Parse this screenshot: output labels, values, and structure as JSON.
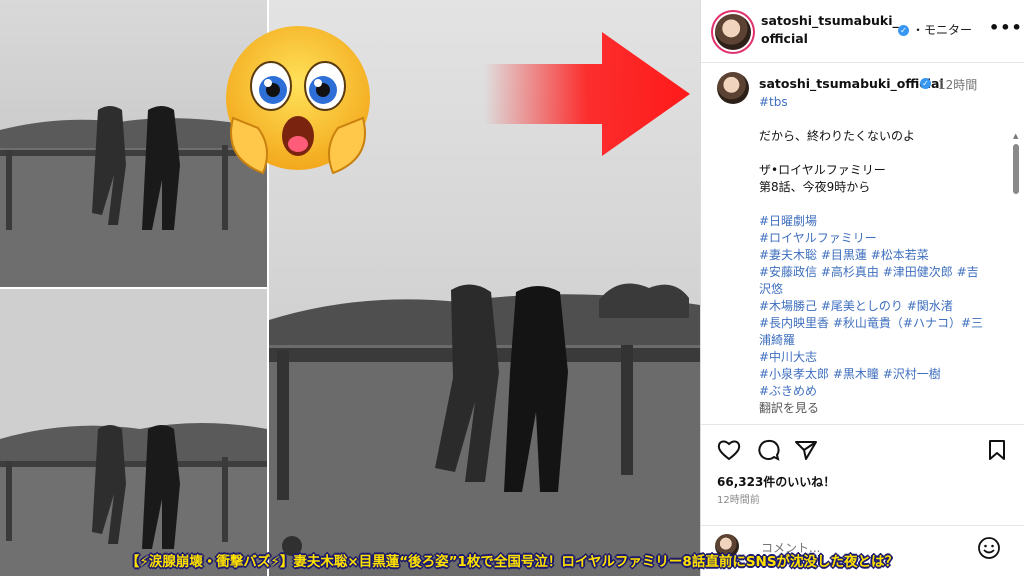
{
  "profile": {
    "username_header": "satoshi_tsumabuki_official",
    "follow_label": "・モニター",
    "verified_mark": "✓"
  },
  "caption": {
    "username": "satoshi_tsumabuki_official",
    "time": "12時間",
    "hashtag_top": "#tbs",
    "line1": "だから、終わりたくないのよ",
    "line2": "ザ•ロイヤルファミリー",
    "line3": "第8話、今夜9時から",
    "tags": [
      "#日曜劇場",
      "#ロイヤルファミリー",
      "#妻夫木聡 #目黒蓮 #松本若菜",
      "#安藤政信 #高杉真由 #津田健次郎 #吉",
      "沢悠",
      "#木場勝己 #尾美としのり #関水渚",
      "#長内映里香 #秋山竜貴（#ハナコ）#三",
      "浦綺羅",
      "#中川大志",
      "#小泉孝太郎 #黒木瞳 #沢村一樹",
      "#ぶきめめ"
    ],
    "translate": "翻訳を見る"
  },
  "engagement": {
    "likes": "66,323件のいいね！",
    "age": "12時間前",
    "comment_placeholder": "コメント..."
  },
  "headline": "【⚡涙腺崩壊・衝撃バズ⚡】妻夫木聡×目黒蓮“後ろ姿”1枚で全国号泣！ロイヤルファミリー8話直前にSNSが沈没した夜とは？",
  "colors": {
    "arrow": "#ff1a1a",
    "headline_text": "#ffe100",
    "headline_outline": "#1c1a6e",
    "hashtag": "#3f6fbf"
  },
  "icons": [
    "heart-icon",
    "comment-icon",
    "share-icon",
    "bookmark-icon",
    "more-icon",
    "smiley-icon",
    "verified-icon"
  ]
}
